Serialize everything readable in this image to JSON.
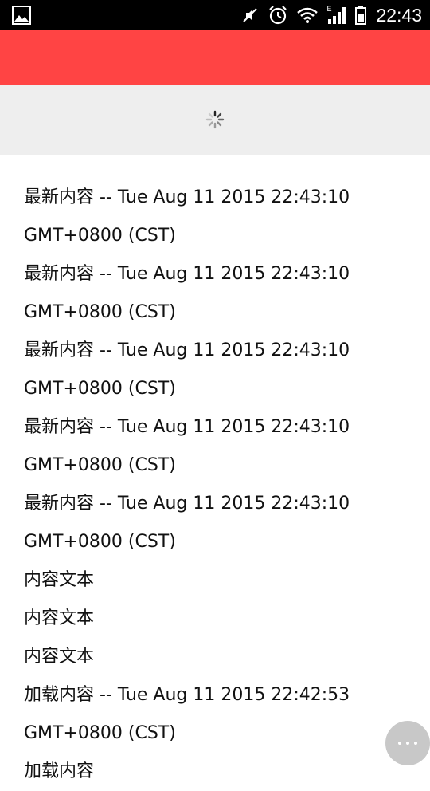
{
  "status_bar": {
    "time": "22:43",
    "network_label": "E",
    "icons": [
      "gallery-icon",
      "mute-vibrate-icon",
      "alarm-icon",
      "wifi-icon",
      "signal-icon",
      "battery-icon"
    ]
  },
  "toolbar": {
    "color": "#ff4444"
  },
  "refresh": {
    "background": "#eeeeee"
  },
  "list": {
    "items": [
      "最新内容 -- Tue Aug 11 2015 22:43:10 GMT+0800 (CST)",
      "最新内容 -- Tue Aug 11 2015 22:43:10 GMT+0800 (CST)",
      "最新内容 -- Tue Aug 11 2015 22:43:10 GMT+0800 (CST)",
      "最新内容 -- Tue Aug 11 2015 22:43:10 GMT+0800 (CST)",
      "最新内容 -- Tue Aug 11 2015 22:43:10 GMT+0800 (CST)",
      "内容文本",
      "内容文本",
      "内容文本",
      "加载内容 -- Tue Aug 11 2015 22:42:53 GMT+0800 (CST)",
      "加载内容"
    ]
  },
  "fab": {
    "icon": "more-dots-icon"
  }
}
